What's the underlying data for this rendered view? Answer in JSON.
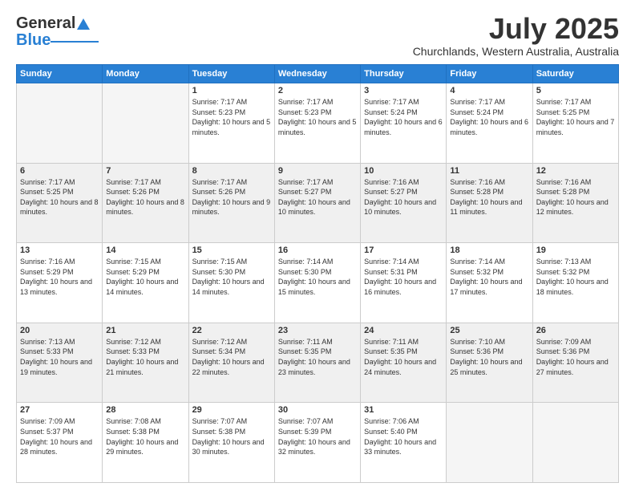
{
  "header": {
    "logo_general": "General",
    "logo_blue": "Blue",
    "month": "July 2025",
    "location": "Churchlands, Western Australia, Australia"
  },
  "weekdays": [
    "Sunday",
    "Monday",
    "Tuesday",
    "Wednesday",
    "Thursday",
    "Friday",
    "Saturday"
  ],
  "weeks": [
    [
      {
        "day": "",
        "empty": true
      },
      {
        "day": "",
        "empty": true
      },
      {
        "day": "1",
        "sunrise": "7:17 AM",
        "sunset": "5:23 PM",
        "daylight": "10 hours and 5 minutes."
      },
      {
        "day": "2",
        "sunrise": "7:17 AM",
        "sunset": "5:23 PM",
        "daylight": "10 hours and 5 minutes."
      },
      {
        "day": "3",
        "sunrise": "7:17 AM",
        "sunset": "5:24 PM",
        "daylight": "10 hours and 6 minutes."
      },
      {
        "day": "4",
        "sunrise": "7:17 AM",
        "sunset": "5:24 PM",
        "daylight": "10 hours and 6 minutes."
      },
      {
        "day": "5",
        "sunrise": "7:17 AM",
        "sunset": "5:25 PM",
        "daylight": "10 hours and 7 minutes."
      }
    ],
    [
      {
        "day": "6",
        "sunrise": "7:17 AM",
        "sunset": "5:25 PM",
        "daylight": "10 hours and 8 minutes."
      },
      {
        "day": "7",
        "sunrise": "7:17 AM",
        "sunset": "5:26 PM",
        "daylight": "10 hours and 8 minutes."
      },
      {
        "day": "8",
        "sunrise": "7:17 AM",
        "sunset": "5:26 PM",
        "daylight": "10 hours and 9 minutes."
      },
      {
        "day": "9",
        "sunrise": "7:17 AM",
        "sunset": "5:27 PM",
        "daylight": "10 hours and 10 minutes."
      },
      {
        "day": "10",
        "sunrise": "7:16 AM",
        "sunset": "5:27 PM",
        "daylight": "10 hours and 10 minutes."
      },
      {
        "day": "11",
        "sunrise": "7:16 AM",
        "sunset": "5:28 PM",
        "daylight": "10 hours and 11 minutes."
      },
      {
        "day": "12",
        "sunrise": "7:16 AM",
        "sunset": "5:28 PM",
        "daylight": "10 hours and 12 minutes."
      }
    ],
    [
      {
        "day": "13",
        "sunrise": "7:16 AM",
        "sunset": "5:29 PM",
        "daylight": "10 hours and 13 minutes."
      },
      {
        "day": "14",
        "sunrise": "7:15 AM",
        "sunset": "5:29 PM",
        "daylight": "10 hours and 14 minutes."
      },
      {
        "day": "15",
        "sunrise": "7:15 AM",
        "sunset": "5:30 PM",
        "daylight": "10 hours and 14 minutes."
      },
      {
        "day": "16",
        "sunrise": "7:14 AM",
        "sunset": "5:30 PM",
        "daylight": "10 hours and 15 minutes."
      },
      {
        "day": "17",
        "sunrise": "7:14 AM",
        "sunset": "5:31 PM",
        "daylight": "10 hours and 16 minutes."
      },
      {
        "day": "18",
        "sunrise": "7:14 AM",
        "sunset": "5:32 PM",
        "daylight": "10 hours and 17 minutes."
      },
      {
        "day": "19",
        "sunrise": "7:13 AM",
        "sunset": "5:32 PM",
        "daylight": "10 hours and 18 minutes."
      }
    ],
    [
      {
        "day": "20",
        "sunrise": "7:13 AM",
        "sunset": "5:33 PM",
        "daylight": "10 hours and 19 minutes."
      },
      {
        "day": "21",
        "sunrise": "7:12 AM",
        "sunset": "5:33 PM",
        "daylight": "10 hours and 21 minutes."
      },
      {
        "day": "22",
        "sunrise": "7:12 AM",
        "sunset": "5:34 PM",
        "daylight": "10 hours and 22 minutes."
      },
      {
        "day": "23",
        "sunrise": "7:11 AM",
        "sunset": "5:35 PM",
        "daylight": "10 hours and 23 minutes."
      },
      {
        "day": "24",
        "sunrise": "7:11 AM",
        "sunset": "5:35 PM",
        "daylight": "10 hours and 24 minutes."
      },
      {
        "day": "25",
        "sunrise": "7:10 AM",
        "sunset": "5:36 PM",
        "daylight": "10 hours and 25 minutes."
      },
      {
        "day": "26",
        "sunrise": "7:09 AM",
        "sunset": "5:36 PM",
        "daylight": "10 hours and 27 minutes."
      }
    ],
    [
      {
        "day": "27",
        "sunrise": "7:09 AM",
        "sunset": "5:37 PM",
        "daylight": "10 hours and 28 minutes."
      },
      {
        "day": "28",
        "sunrise": "7:08 AM",
        "sunset": "5:38 PM",
        "daylight": "10 hours and 29 minutes."
      },
      {
        "day": "29",
        "sunrise": "7:07 AM",
        "sunset": "5:38 PM",
        "daylight": "10 hours and 30 minutes."
      },
      {
        "day": "30",
        "sunrise": "7:07 AM",
        "sunset": "5:39 PM",
        "daylight": "10 hours and 32 minutes."
      },
      {
        "day": "31",
        "sunrise": "7:06 AM",
        "sunset": "5:40 PM",
        "daylight": "10 hours and 33 minutes."
      },
      {
        "day": "",
        "empty": true
      },
      {
        "day": "",
        "empty": true
      }
    ]
  ]
}
